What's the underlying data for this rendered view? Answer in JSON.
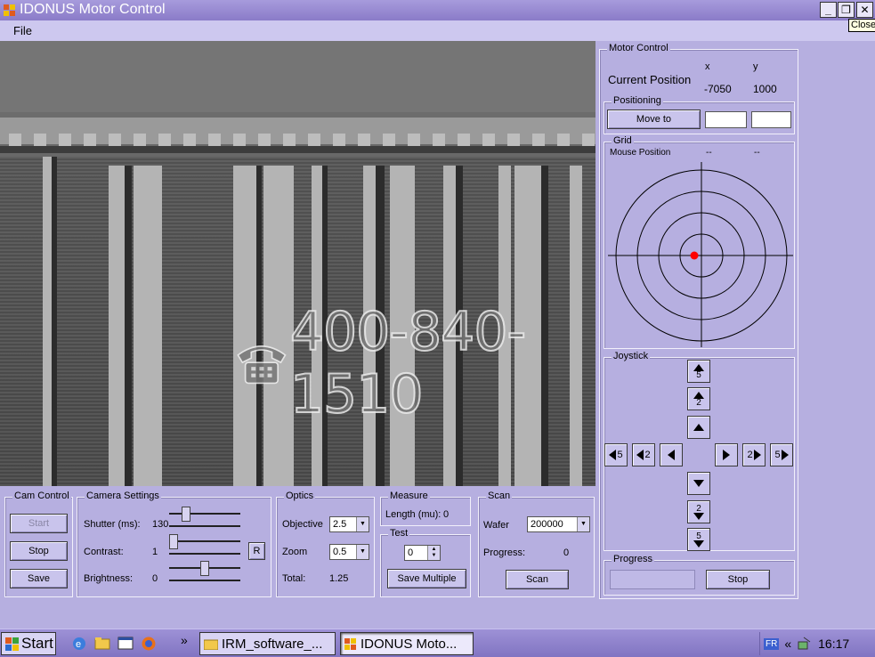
{
  "window": {
    "title": "IDONUS Motor Control",
    "minimize": "_",
    "maximize": "❐",
    "close": "✕",
    "tooltip": "Close"
  },
  "menu": {
    "file": "File"
  },
  "camera": {
    "watermark": "400-840-1510",
    "watermark_icon": "phone-icon"
  },
  "cam_control": {
    "title": "Cam Control",
    "start": "Start",
    "stop": "Stop",
    "save": "Save"
  },
  "camera_settings": {
    "title": "Camera Settings",
    "shutter_label": "Shutter (ms):",
    "shutter_value": "130",
    "shutter_level": 0.2,
    "contrast_label": "Contrast:",
    "contrast_value": "1",
    "contrast_level": 0.0,
    "brightness_label": "Brightness:",
    "brightness_value": "0",
    "brightness_level": 0.5,
    "reset": "R"
  },
  "optics": {
    "title": "Optics",
    "objective_label": "Objective",
    "objective_value": "2.5",
    "zoom_label": "Zoom",
    "zoom_value": "0.5",
    "total_label": "Total:",
    "total_value": "1.25"
  },
  "measure": {
    "title": "Measure",
    "length_label": "Length (mu):",
    "length_value": "0"
  },
  "test": {
    "title": "Test",
    "spin_value": "0",
    "save_multiple": "Save Multiple"
  },
  "scan": {
    "title": "Scan",
    "wafer_label": "Wafer",
    "wafer_value": "200000",
    "progress_label": "Progress:",
    "progress_value": "0",
    "scan_button": "Scan"
  },
  "motor": {
    "title": "Motor Control",
    "x_header": "x",
    "y_header": "y",
    "current_position_label": "Current Position",
    "x_value": "-7050",
    "y_value": "1000"
  },
  "positioning": {
    "title": "Positioning",
    "move_to": "Move to",
    "x_input": "",
    "y_input": ""
  },
  "grid": {
    "title": "Grid",
    "mouse_position_label": "Mouse Position",
    "mouse_x": "--",
    "mouse_y": "--",
    "marker_color": "#ff0000"
  },
  "joystick": {
    "title": "Joystick",
    "up5": "5",
    "up2": "2",
    "down2": "2",
    "down5": "5",
    "left5": "5",
    "left2": "2",
    "right2": "2",
    "right5": "5"
  },
  "progress_group": {
    "title": "Progress",
    "stop": "Stop",
    "level": 0
  },
  "taskbar": {
    "start": "Start",
    "overflow": "»",
    "task1": "IRM_software_...",
    "task2": "IDONUS Moto...",
    "lang": "FR",
    "tray_chevron": "«",
    "clock": "16:17"
  }
}
